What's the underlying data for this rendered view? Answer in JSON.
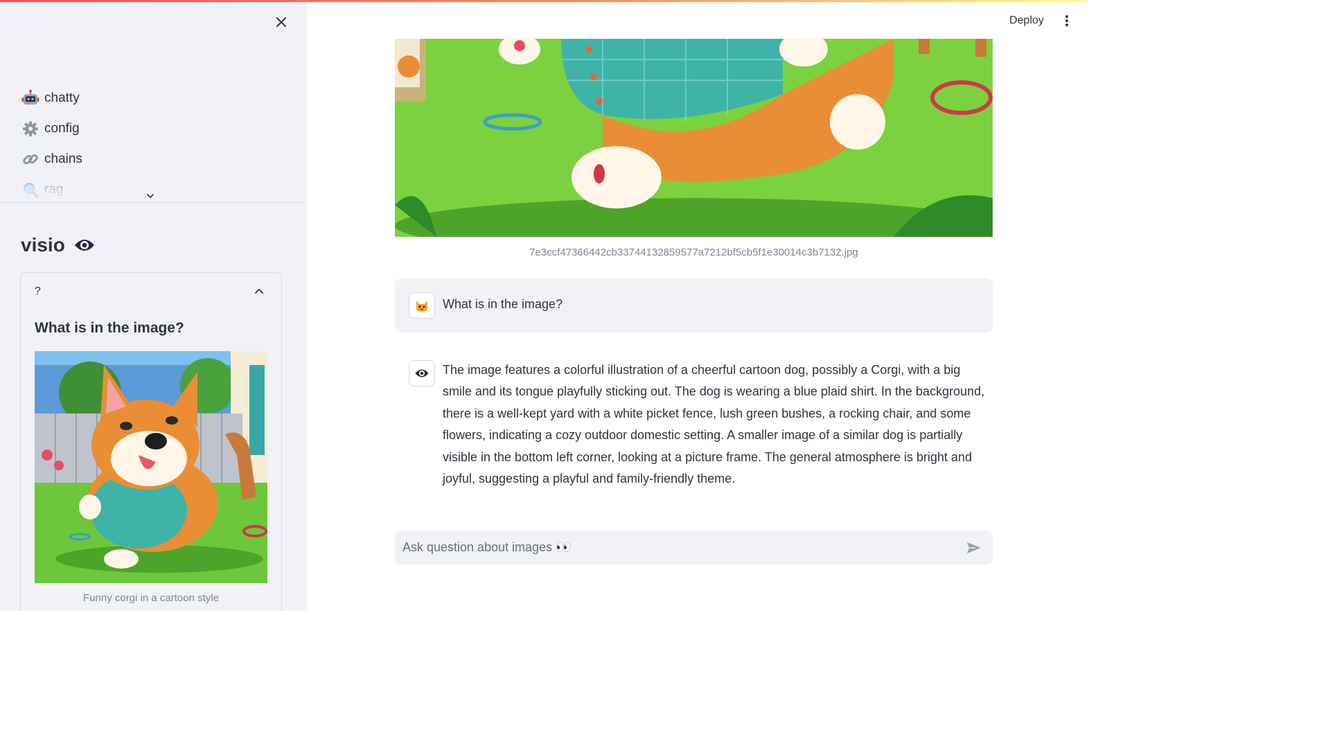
{
  "app": {
    "header": {
      "deploy_label": "Deploy",
      "menu_icon": "kebab-icon"
    },
    "colors": {
      "accent": "#ff4b4b",
      "sidebar_bg": "#f0f2f6",
      "text": "#31333f",
      "muted": "#808495"
    }
  },
  "sidebar": {
    "close_icon": "close-icon",
    "nav": [
      {
        "icon": "robot-icon",
        "label": "chatty"
      },
      {
        "icon": "gear-icon",
        "label": "config"
      },
      {
        "icon": "link-icon",
        "label": "chains"
      },
      {
        "icon": "magnifier-icon",
        "label": "rag"
      }
    ],
    "page_title": "visio",
    "expander": {
      "header": "?",
      "question": "What is in the image?",
      "image_caption": "Funny corgi in a cartoon style"
    }
  },
  "main": {
    "image_caption": "7e3ccf47366442cb33744132859577a7212bf5cb5f1e30014c3b7132.jpg",
    "messages": [
      {
        "role": "user",
        "avatar": "cat-icon",
        "text": "What is in the image?"
      },
      {
        "role": "assistant",
        "avatar": "eye-icon",
        "text": "The image features a colorful illustration of a cheerful cartoon dog, possibly a Corgi, with a big smile and its tongue playfully sticking out. The dog is wearing a blue plaid shirt. In the background, there is a well-kept yard with a white picket fence, lush green bushes, a rocking chair, and some flowers, indicating a cozy outdoor domestic setting. A smaller image of a similar dog is partially visible in the bottom left corner, looking at a picture frame. The general atmosphere is bright and joyful, suggesting a playful and family-friendly theme."
      }
    ],
    "chat_input": {
      "placeholder": "Ask question about images 👀",
      "value": ""
    }
  }
}
